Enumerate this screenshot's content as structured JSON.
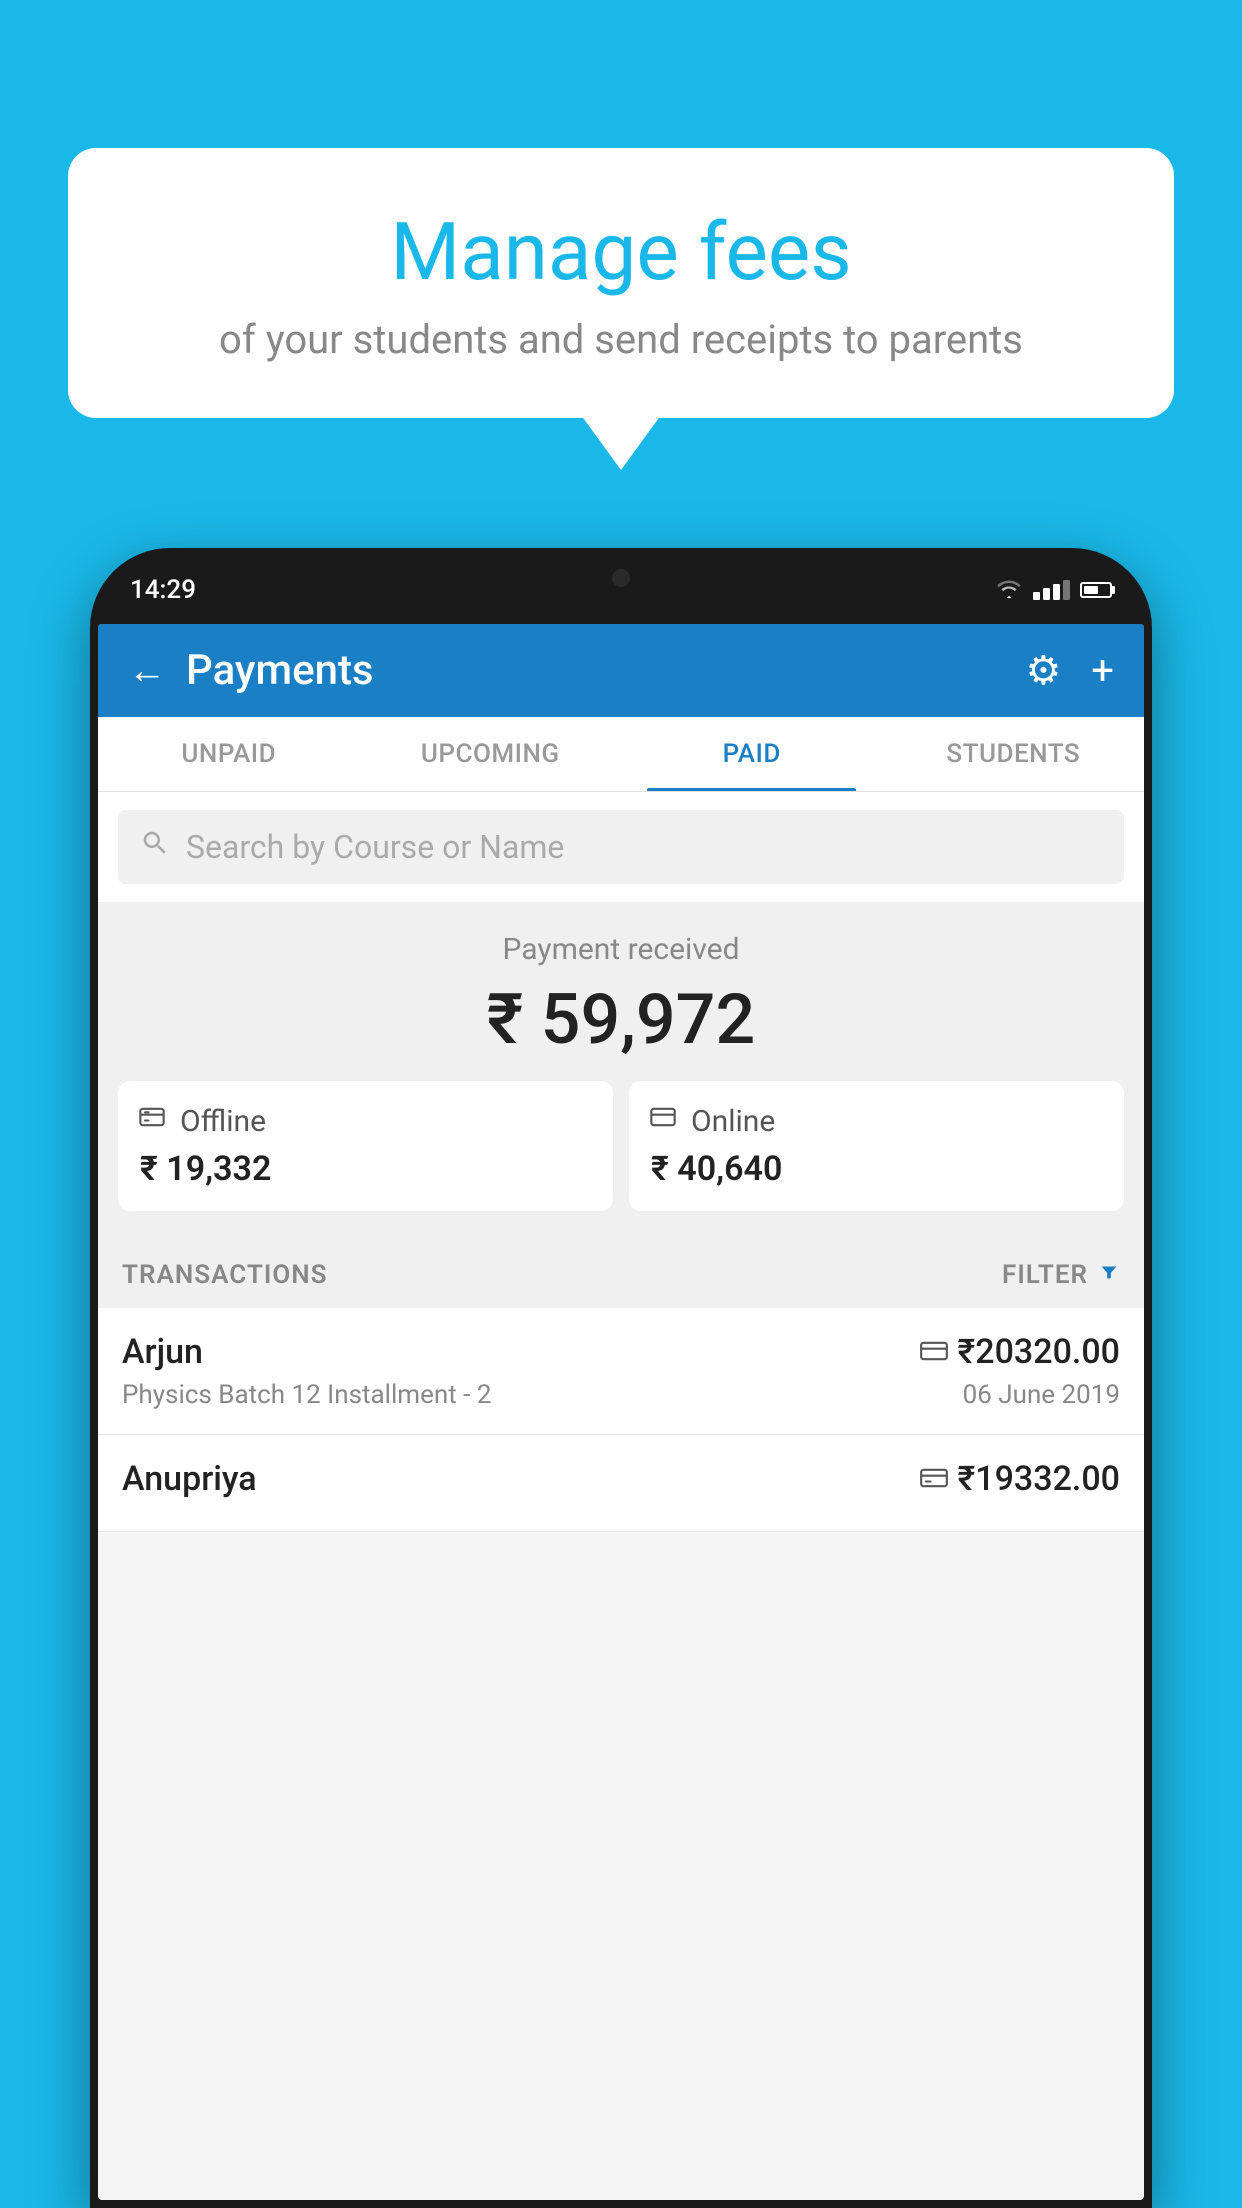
{
  "background_color": "#1ab8e8",
  "speech_bubble": {
    "title": "Manage fees",
    "subtitle": "of your students and send receipts to parents"
  },
  "phone": {
    "status_bar": {
      "time": "14:29"
    },
    "header": {
      "title": "Payments",
      "back_label": "←",
      "gear_label": "⚙",
      "plus_label": "+"
    },
    "tabs": [
      {
        "label": "UNPAID",
        "active": false
      },
      {
        "label": "UPCOMING",
        "active": false
      },
      {
        "label": "PAID",
        "active": true
      },
      {
        "label": "STUDENTS",
        "active": false
      }
    ],
    "search": {
      "placeholder": "Search by Course or Name"
    },
    "payment_summary": {
      "label": "Payment received",
      "amount": "₹ 59,972",
      "offline": {
        "type": "Offline",
        "amount": "₹ 19,332"
      },
      "online": {
        "type": "Online",
        "amount": "₹ 40,640"
      }
    },
    "transactions": {
      "header_label": "TRANSACTIONS",
      "filter_label": "FILTER",
      "items": [
        {
          "name": "Arjun",
          "course": "Physics Batch 12 Installment - 2",
          "amount": "₹20320.00",
          "date": "06 June 2019",
          "icon": "card"
        },
        {
          "name": "Anupriya",
          "course": "",
          "amount": "₹19332.00",
          "date": "",
          "icon": "offline"
        }
      ]
    }
  }
}
